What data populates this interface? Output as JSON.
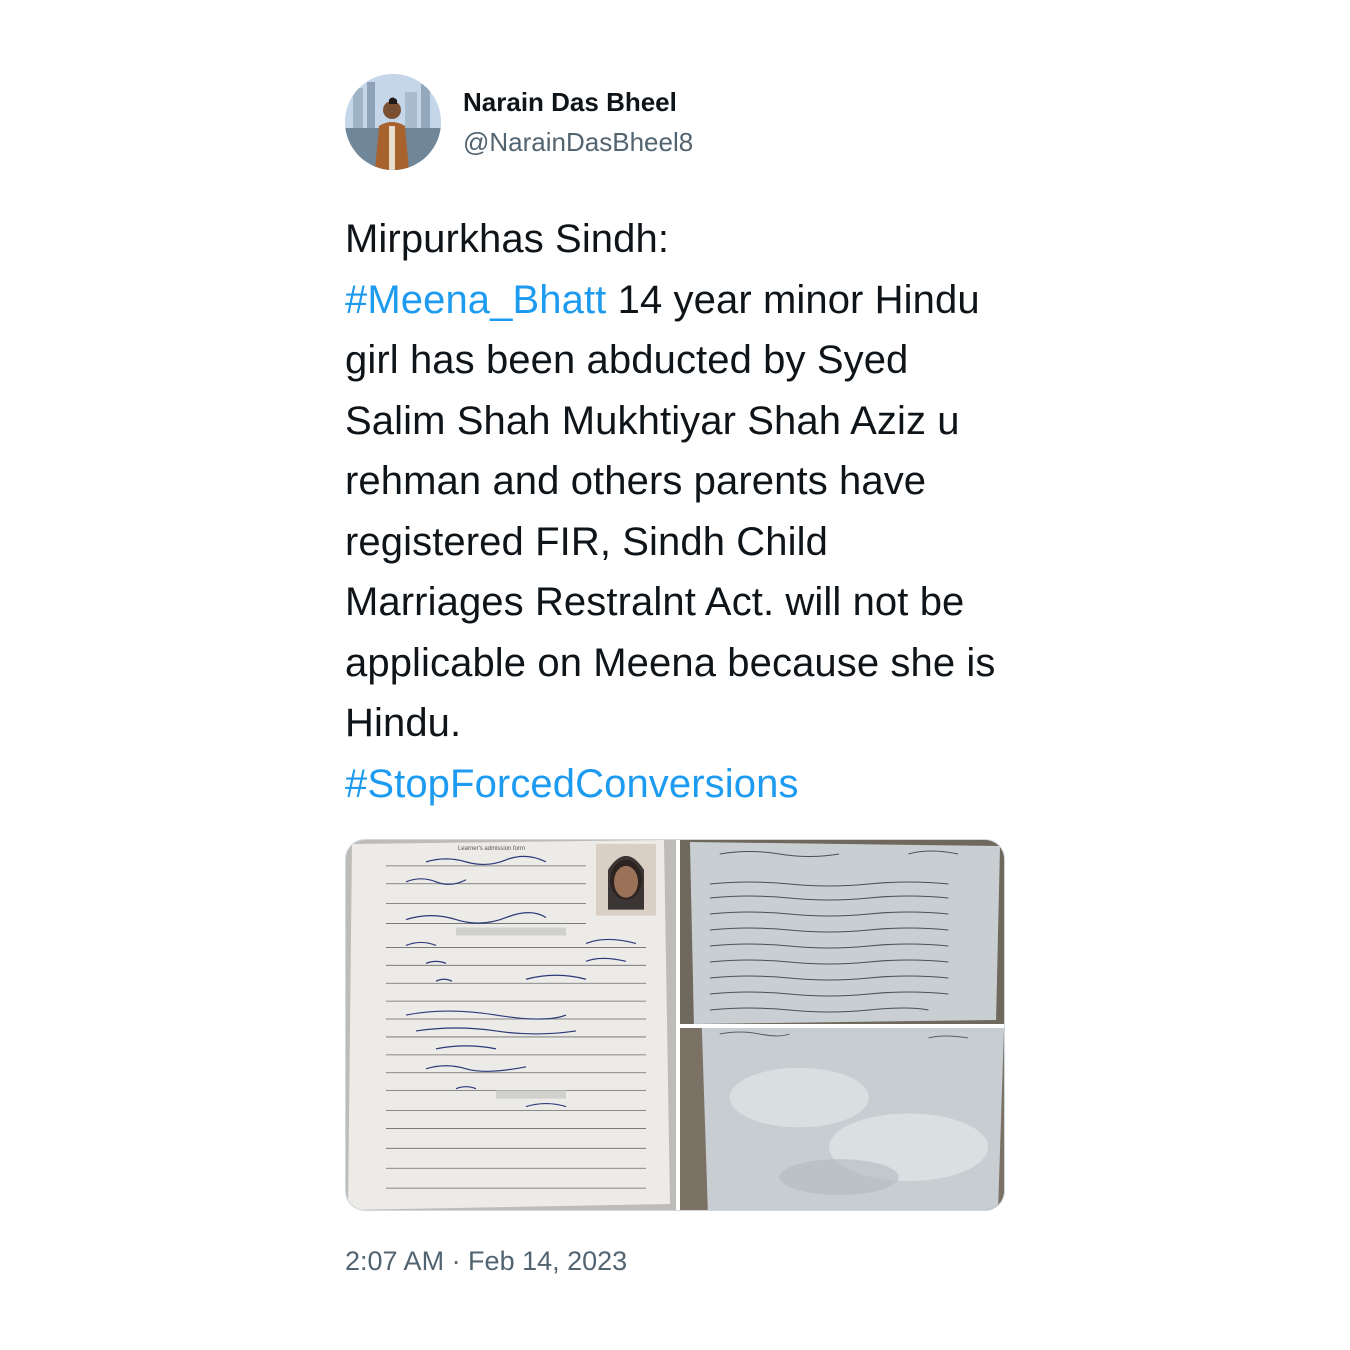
{
  "author": {
    "display_name": "Narain Das Bheel",
    "handle": "@NarainDasBheel8",
    "avatar_icon": "profile-photo"
  },
  "tweet": {
    "text_line_1": "Mirpurkhas Sindh:",
    "hashtag_1": "#Meena_Bhatt",
    "text_body": " 14 year minor Hindu girl has been abducted by Syed Salim Shah Mukhtiyar Shah Aziz u rehman and others parents have registered FIR, Sindh Child Marriages Restralnt Act. will not be applicable on Meena because she is Hindu.",
    "hashtag_2": "#StopForcedConversions",
    "hashtag_color": "#1d9bf0"
  },
  "media": {
    "images": [
      {
        "icon": "admission-form-photo",
        "form_title": "Learner's admission form"
      },
      {
        "icon": "urdu-handwritten-document-photo"
      },
      {
        "icon": "plastic-sleeve-document-photo"
      }
    ]
  },
  "timestamp": "2:07 AM · Feb 14, 2023"
}
